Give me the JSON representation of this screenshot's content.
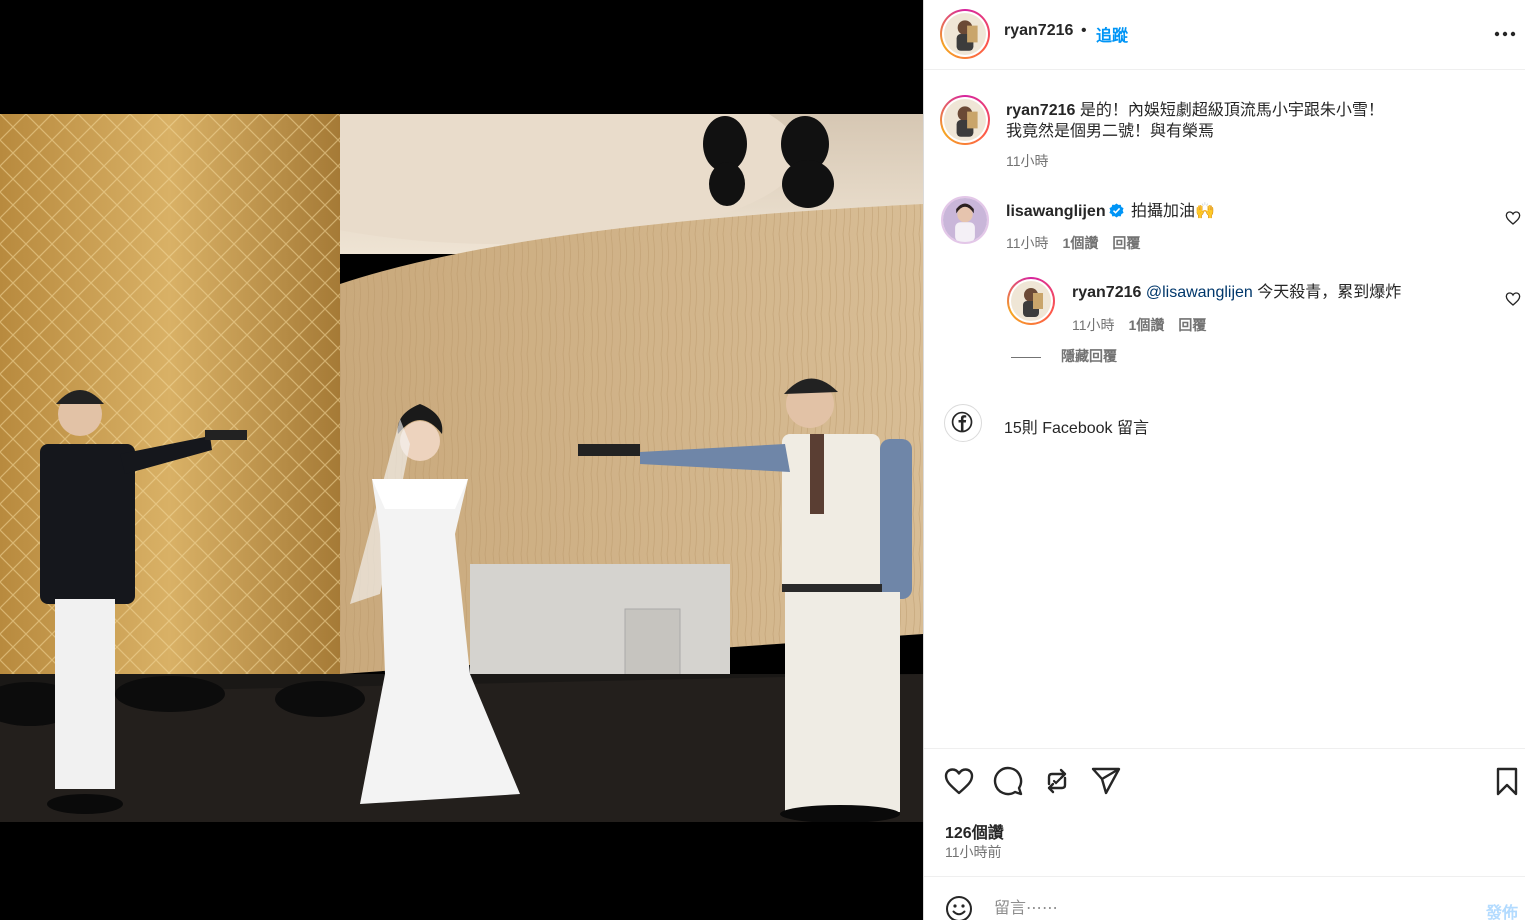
{
  "post": {
    "author": "ryan7216",
    "separator": "•",
    "follow_label": "追蹤",
    "more_icon": "more-horizontal-icon"
  },
  "caption": {
    "user": "ryan7216",
    "line1": "是的！內娛短劇超級頂流馬小宇跟朱小雪！",
    "line2": "我竟然是個男二號！與有榮焉",
    "time": "11小時"
  },
  "comments": [
    {
      "user": "lisawanglijen",
      "verified": true,
      "text": "拍攝加油🙌",
      "time": "11小時",
      "likes": "1個讚",
      "reply_label": "回覆"
    }
  ],
  "replies": [
    {
      "user": "ryan7216",
      "mention": "@lisawanglijen",
      "text": "今天殺青，累到爆炸",
      "time": "11小時",
      "likes": "1個讚",
      "reply_label": "回覆"
    }
  ],
  "hide_replies_label": "隱藏回覆",
  "facebook": {
    "label": "15則 Facebook 留言"
  },
  "stats": {
    "likes": "126個讚",
    "time_ago": "11小時前"
  },
  "composer": {
    "placeholder": "留言⋯⋯",
    "post_label": "發佈"
  },
  "colors": {
    "link_blue": "#0095f6",
    "mention_blue": "#00376b",
    "muted_gray": "#737373",
    "post_disabled": "#b3dbff"
  }
}
